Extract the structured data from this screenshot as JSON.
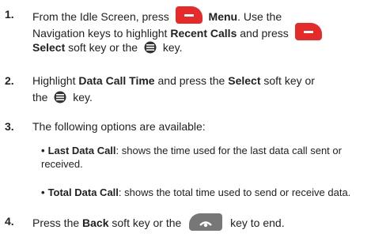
{
  "steps": [
    {
      "num": "1.",
      "l1a": "From the Idle Screen, press",
      "l1b": "Menu",
      "l1c": ". Use the",
      "l2a": "Navigation keys to highlight",
      "l2b": "Recent Calls",
      "l2c": "and press",
      "l3a": "Select",
      "l3b": "soft key or the",
      "l3c": "key."
    },
    {
      "num": "2.",
      "l1a": "Highlight",
      "l1b": "Data Call Time",
      "l1c": "and press the",
      "l1d": "Select",
      "l1e": "soft key or",
      "l2a": "the",
      "l2b": "key."
    },
    {
      "num": "3.",
      "l1": "The following options are available:",
      "bullets": [
        {
          "term": "Last Data Call",
          "desc1": ": shows the time used for the last data call sent or",
          "desc2": "received."
        },
        {
          "term": "Total Data Call",
          "desc1": ": shows the total time used to send or receive data."
        }
      ]
    },
    {
      "num": "4.",
      "l1a": "Press the",
      "l1b": "Back",
      "l1c": "soft key or the",
      "l1d": "key to end."
    }
  ],
  "icons": {
    "soft_key": "red-soft-key-icon",
    "nav_key": "navigation-key-icon",
    "end_key": "end-key-icon",
    "soft_key_color": "#e62a2a",
    "end_key_color": "#777777"
  }
}
